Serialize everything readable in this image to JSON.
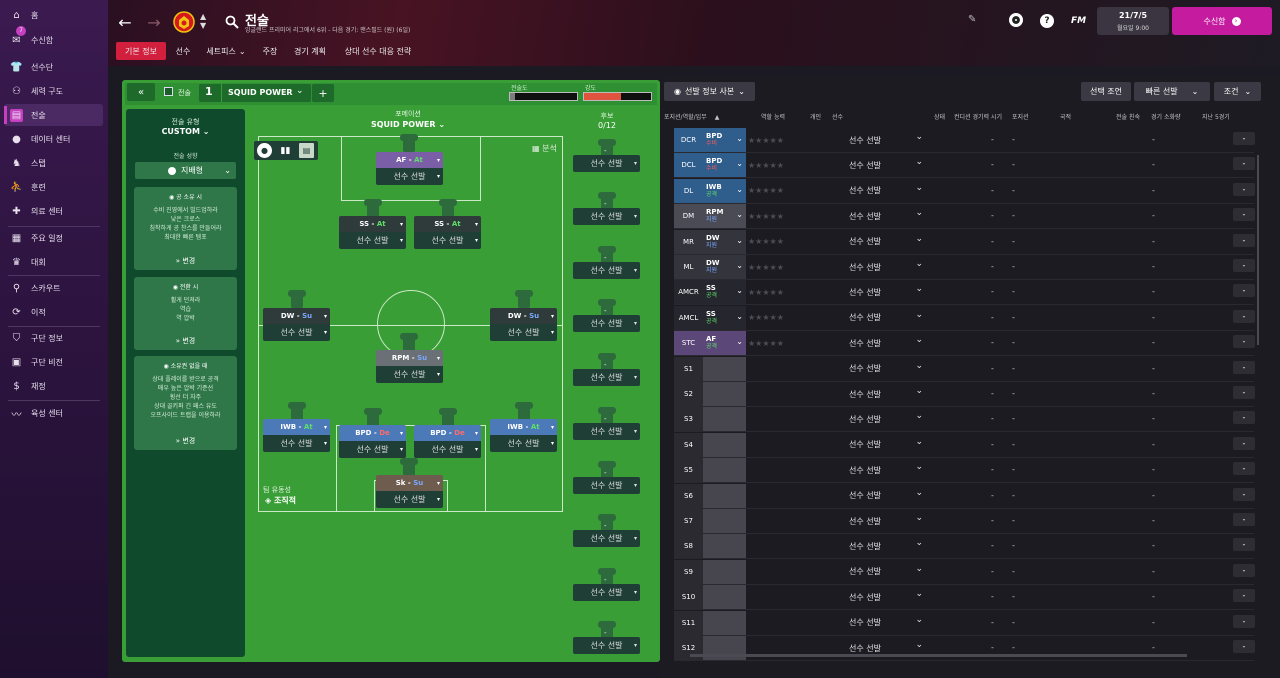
{
  "nav": {
    "items": [
      {
        "key": "home",
        "label": "홈",
        "icon": "home-icon"
      },
      {
        "key": "inbox",
        "label": "수신함",
        "icon": "inbox-icon",
        "badge": "7"
      },
      {
        "key": "squad",
        "label": "선수단",
        "icon": "shirt-icon"
      },
      {
        "key": "dynamics",
        "label": "세력 구도",
        "icon": "people-icon"
      },
      {
        "key": "tactics",
        "label": "전술",
        "icon": "tactics-icon"
      },
      {
        "key": "data",
        "label": "데이터 센터",
        "icon": "data-icon"
      },
      {
        "key": "staff",
        "label": "스탭",
        "icon": "staff-icon"
      },
      {
        "key": "training",
        "label": "훈련",
        "icon": "training-icon"
      },
      {
        "key": "medical",
        "label": "의료 센터",
        "icon": "medical-icon"
      },
      {
        "key": "schedule",
        "label": "주요 일정",
        "icon": "calendar-icon"
      },
      {
        "key": "competitions",
        "label": "대회",
        "icon": "trophy-icon"
      },
      {
        "key": "scouting",
        "label": "스카우트",
        "icon": "scout-icon"
      },
      {
        "key": "transfers",
        "label": "이적",
        "icon": "transfer-icon"
      },
      {
        "key": "club_info",
        "label": "구단 정보",
        "icon": "shield-icon"
      },
      {
        "key": "club_vision",
        "label": "구단 비전",
        "icon": "briefcase-icon"
      },
      {
        "key": "finances",
        "label": "재정",
        "icon": "finance-icon"
      },
      {
        "key": "dev_centre",
        "label": "육성 센터",
        "icon": "youth-icon"
      }
    ]
  },
  "header": {
    "title": "전술",
    "subtitle": "잉글랜드 프리미어 리그에서 6위 - 다음 경기: 맨스필드 (원) (6일)",
    "date": "21/7/5",
    "day_time": "월요일 9:00",
    "inbox_button": "수신함",
    "fm": "FM",
    "tabs": [
      "기본 정보",
      "선수",
      "세트피스",
      "주장",
      "경기 계획",
      "상대 선수 대응 전략"
    ],
    "tab_dropdown_marker": "⌄"
  },
  "tactic": {
    "label": "전술",
    "slot": "1",
    "name": "SQUID POWER",
    "add": "+",
    "familiarity_label": "전술도",
    "intensity_label": "강도",
    "familiarity_pct": 8,
    "intensity_pct": 55,
    "type_label": "전술 유형",
    "type_value": "CUSTOM",
    "mentality_label": "전술 성향",
    "mentality_value": "지배형",
    "formation_label": "포메이션",
    "formation_value": "SQUID POWER",
    "subs_label": "후보",
    "subs_count": "0/12",
    "analysis": "분석",
    "fluidity_label": "팀 유동성",
    "fluidity_value": "조직적",
    "in_possession": {
      "title": "공 소유 시",
      "lines": [
        "수비 진영에서 빌드업하라",
        "낮은 크로스",
        "침착하게 공 찬스를 만들어라",
        "최대한 빠른 템포"
      ],
      "change": "변경"
    },
    "transition": {
      "title": "전환 시",
      "lines": [
        "휠게 던져라",
        "역습",
        "역 압박"
      ],
      "change": "변경"
    },
    "out_of_possession": {
      "title": "소유권 없을 때",
      "lines": [
        "상대 플레이를 받으로 공격",
        "매우 높은 압박 기준선",
        "횡선 더 자주",
        "상대 골키퍼 긴 패스 유도",
        "오프사이드 트랩을 이용하라"
      ],
      "change": "변경"
    },
    "select_player": "선수 선발"
  },
  "players": [
    {
      "role": "AF",
      "duty": "At",
      "duty_color": "#5ee06a",
      "role_bg": "#7a5fa6"
    },
    {
      "role": "SS",
      "duty": "At",
      "duty_color": "#5ee06a",
      "role_bg": "#2f3a3a"
    },
    {
      "role": "SS",
      "duty": "At",
      "duty_color": "#5ee06a",
      "role_bg": "#2f3a3a"
    },
    {
      "role": "DW",
      "duty": "Su",
      "duty_color": "#7aa9ff",
      "role_bg": "#2f3a3a"
    },
    {
      "role": "DW",
      "duty": "Su",
      "duty_color": "#7aa9ff",
      "role_bg": "#2f3a3a"
    },
    {
      "role": "RPM",
      "duty": "Su",
      "duty_color": "#7aa9ff",
      "role_bg": "#6b6f76"
    },
    {
      "role": "IWB",
      "duty": "At",
      "duty_color": "#5ee06a",
      "role_bg": "#4c79b8"
    },
    {
      "role": "BPD",
      "duty": "De",
      "duty_color": "#ff6b6b",
      "role_bg": "#4c79b8"
    },
    {
      "role": "BPD",
      "duty": "De",
      "duty_color": "#ff6b6b",
      "role_bg": "#4c79b8"
    },
    {
      "role": "IWB",
      "duty": "At",
      "duty_color": "#5ee06a",
      "role_bg": "#4c79b8"
    },
    {
      "role": "Sk",
      "duty": "Su",
      "duty_color": "#7aa9ff",
      "role_bg": "#6e5c4e"
    }
  ],
  "subs_dash": "-",
  "selection": {
    "view_button": "선발 정보 사본",
    "criteria": "선택 조언",
    "quick_pick": "빠른 선발",
    "conditions": "조건",
    "headers": [
      "포지션/역할/임무",
      "역할 능력",
      "개인",
      "선수",
      "상태",
      "컨디션 경기력 시기",
      "포지션",
      "국적",
      "전술 친숙",
      "경기 소화량",
      "지난 5경기"
    ],
    "sort_marker": "▲",
    "rows": [
      {
        "pos": "DCR",
        "role": "BPD",
        "duty": "수비",
        "duty_color": "#ff5a5a",
        "bg": "#2f5d8c"
      },
      {
        "pos": "DCL",
        "role": "BPD",
        "duty": "수비",
        "duty_color": "#ff5a5a",
        "bg": "#2f5d8c"
      },
      {
        "pos": "DL",
        "role": "IWB",
        "duty": "공격",
        "duty_color": "#5ee06a",
        "bg": "#2f5d8c"
      },
      {
        "pos": "DM",
        "role": "RPM",
        "duty": "지원",
        "duty_color": "#7aa9ff",
        "bg": "#4a4b55"
      },
      {
        "pos": "MR",
        "role": "DW",
        "duty": "지원",
        "duty_color": "#7aa9ff",
        "bg": "#33343c"
      },
      {
        "pos": "ML",
        "role": "DW",
        "duty": "지원",
        "duty_color": "#7aa9ff",
        "bg": "#33343c"
      },
      {
        "pos": "AMCR",
        "role": "SS",
        "duty": "공격",
        "duty_color": "#5ee06a",
        "bg": "#26272e"
      },
      {
        "pos": "AMCL",
        "role": "SS",
        "duty": "공격",
        "duty_color": "#5ee06a",
        "bg": "#26272e"
      },
      {
        "pos": "STC",
        "role": "AF",
        "duty": "공격",
        "duty_color": "#5ee06a",
        "bg": "#5b4778"
      },
      {
        "pos": "S1"
      },
      {
        "pos": "S2"
      },
      {
        "pos": "S3"
      },
      {
        "pos": "S4"
      },
      {
        "pos": "S5"
      },
      {
        "pos": "S6"
      },
      {
        "pos": "S7"
      },
      {
        "pos": "S8"
      },
      {
        "pos": "S9"
      },
      {
        "pos": "S10"
      },
      {
        "pos": "S11"
      },
      {
        "pos": "S12"
      }
    ],
    "dash": "-",
    "star_string": "★★★★★"
  }
}
